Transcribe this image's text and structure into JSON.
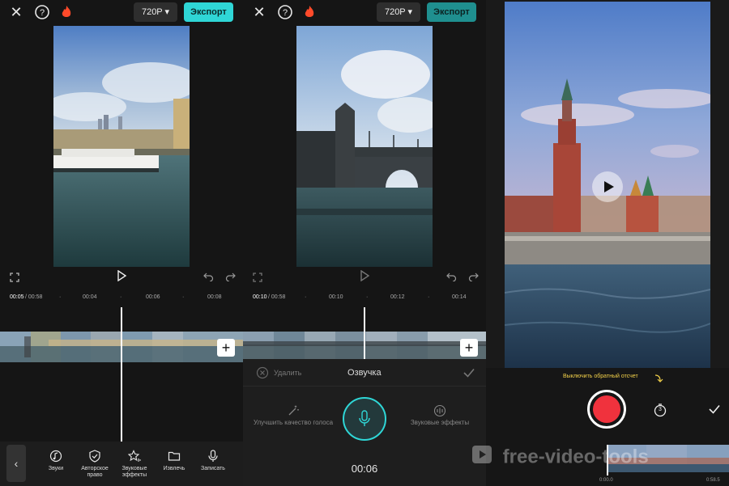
{
  "topbar": {
    "resolution": "720P ▾",
    "export_label": "Экспорт"
  },
  "panel1": {
    "timecode_current": "00:05",
    "timecode_total": " / 00:58",
    "ruler_ticks": [
      "00:04",
      "00:06",
      "00:08"
    ]
  },
  "panel2": {
    "timecode_current": "00:10",
    "timecode_total": " / 00:58",
    "ruler_ticks": [
      "00:10",
      "00:12",
      "00:14"
    ],
    "voiceover": {
      "delete_label": "Удалить",
      "title": "Озвучка",
      "enhance_label": "Улучшить качество голоса",
      "effects_label": "Звуковые эффекты",
      "timer": "00:06"
    }
  },
  "toolbar": {
    "items": [
      {
        "label": "Звуки",
        "icon": "music-note-icon"
      },
      {
        "label": "Авторское право",
        "icon": "shield-check-icon"
      },
      {
        "label": "Звуковые эффекты",
        "icon": "star-sound-icon"
      },
      {
        "label": "Извлечь",
        "icon": "folder-icon"
      },
      {
        "label": "Записать",
        "icon": "microphone-icon"
      }
    ]
  },
  "panel3": {
    "countdown_label": "Выключить обратный отсчет",
    "timer_badge": "3",
    "time_start": "0:00.0",
    "time_end": "0:58.5"
  },
  "watermark": "free-video-tools"
}
